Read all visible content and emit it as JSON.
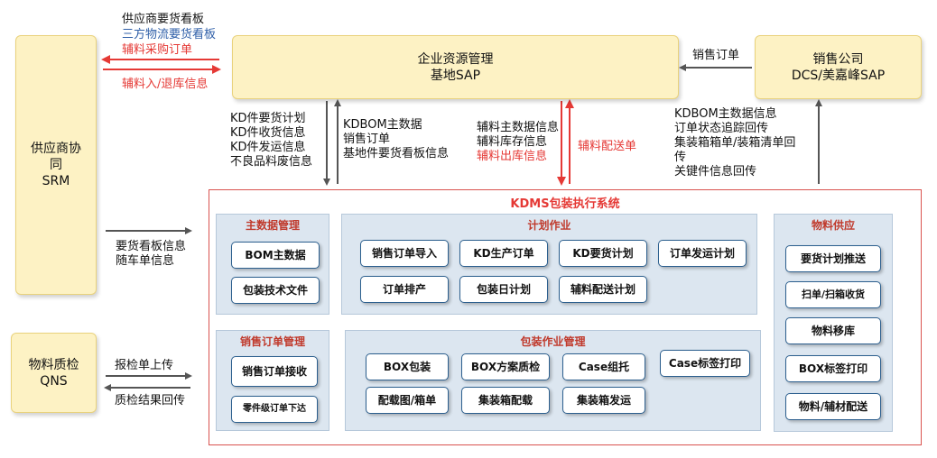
{
  "srm": {
    "lines": [
      "供应商协",
      "同",
      "SRM"
    ]
  },
  "sap": {
    "lines": [
      "企业资源管理",
      "基地SAP"
    ]
  },
  "sales": {
    "lines": [
      "销售公司",
      "DCS/美嘉峰SAP"
    ]
  },
  "qns": {
    "lines": [
      "物料质检",
      "QNS"
    ]
  },
  "top_left_labels": {
    "l1": "供应商要货看板",
    "l2": "三方物流要货看板",
    "l3": "辅料采购订单",
    "l4": "辅料入/退库信息"
  },
  "sales_order_label": "销售订单",
  "flow_sap_to_kdms": [
    "KD件要货计划",
    "KD件收货信息",
    "KD件发运信息",
    "不良品料废信息"
  ],
  "flow_kdms_to_sap": [
    "KDBOM主数据",
    "销售订单",
    "基地件要货看板信息"
  ],
  "flow_aux": {
    "l1": "辅料主数据信息",
    "l2": "辅料库存信息",
    "l3": "辅料出库信息",
    "delivery": "辅料配送单"
  },
  "flow_right": [
    "KDBOM主数据信息",
    "订单状态追踪回传",
    "集装箱箱单/装箱清单回",
    "传",
    "关键件信息回传"
  ],
  "flow_srm": [
    "要货看板信息",
    "随车单信息"
  ],
  "flow_qns": {
    "report": "报检单上传",
    "result": "质检结果回传"
  },
  "kdms": {
    "title": "KDMS包装执行系统",
    "master": {
      "title": "主数据管理",
      "items": [
        "BOM主数据",
        "包装技术文件"
      ]
    },
    "plan": {
      "title": "计划作业",
      "items": [
        "销售订单导入",
        "KD生产订单",
        "KD要货计划",
        "订单发运计划",
        "订单排产",
        "包装日计划",
        "辅料配送计划"
      ]
    },
    "sales_order": {
      "title": "销售订单管理",
      "items": [
        "销售订单接收",
        "零件级订单下达"
      ]
    },
    "pack": {
      "title": "包装作业管理",
      "items": [
        "BOX包装",
        "BOX方案质检",
        "Case组托",
        "Case标签打印",
        "配载图/箱单",
        "集装箱配载",
        "集装箱发运"
      ]
    },
    "supply": {
      "title": "物料供应",
      "items": [
        "要货计划推送",
        "扫单/扫箱收货",
        "物料移库",
        "BOX标签打印",
        "物料/辅材配送"
      ]
    }
  },
  "colors": {
    "red": "#e53935",
    "blue": "#2f5fa8",
    "arrow": "#555555",
    "box_yellow": "#fdf2c4",
    "panel": "#dce6f0"
  }
}
